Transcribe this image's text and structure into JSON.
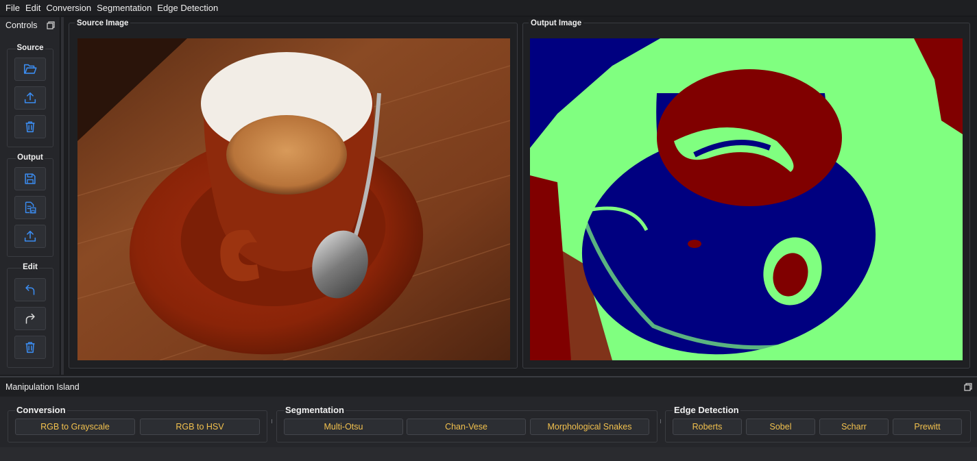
{
  "menubar": {
    "items": [
      "File",
      "Edit",
      "Conversion",
      "Segmentation",
      "Edge Detection"
    ]
  },
  "controls": {
    "title": "Controls",
    "groups": [
      {
        "title": "Source",
        "buttons": [
          "open-folder-icon",
          "upload-icon",
          "trash-icon"
        ]
      },
      {
        "title": "Output",
        "buttons": [
          "save-icon",
          "save-as-icon",
          "export-icon"
        ]
      },
      {
        "title": "Edit",
        "buttons": [
          "undo-icon",
          "redo-icon",
          "clear-icon"
        ]
      }
    ]
  },
  "panels": {
    "source_title": "Source Image",
    "output_title": "Output Image"
  },
  "island": {
    "title": "Manipulation Island",
    "conversion": {
      "title": "Conversion",
      "buttons": [
        "RGB to Grayscale",
        "RGB to HSV"
      ]
    },
    "segmentation": {
      "title": "Segmentation",
      "buttons": [
        "Multi-Otsu",
        "Chan-Vese",
        "Morphological Snakes"
      ]
    },
    "edge": {
      "title": "Edge Detection",
      "buttons": [
        "Roberts",
        "Sobel",
        "Scharr",
        "Prewitt"
      ]
    }
  },
  "colors": {
    "accent_icon": "#3b8cf0",
    "button_text": "#f2c14e",
    "seg_blue": "#000080",
    "seg_green": "#80ff80",
    "seg_red": "#800000"
  }
}
